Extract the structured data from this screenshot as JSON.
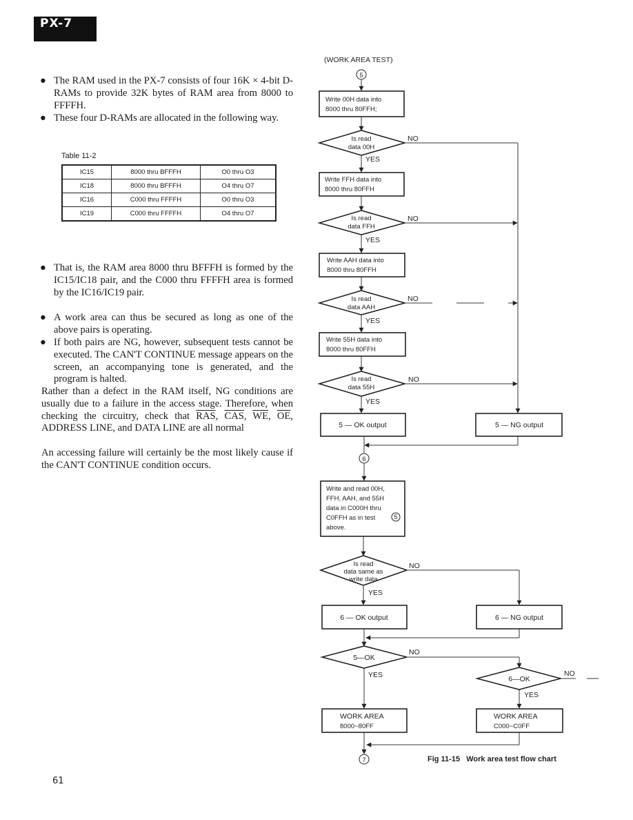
{
  "header": {
    "model": "PX-7"
  },
  "body_text": {
    "bullets_top": [
      "The RAM used in the PX-7 consists of four 16K × 4-bit D-RAMs to provide 32K bytes of RAM area from 8000 to FFFFH.",
      "These four D-RAMs are allocated in the following way."
    ],
    "bullets_bottom": [
      "That is, the RAM area 8000 thru BFFFH is formed by the IC15/IC18 pair, and the C000 thru FFFFH area is formed by the IC16/IC19 pair.",
      "A work area can thus be secured as long as one of the above pairs is operating.",
      "If both pairs are NG, however, subsequent tests cannot be executed. The CAN'T CONTINUE message appears on the screen, an accompanying tone is generated, and the program is halted."
    ],
    "para_access_1": "Rather than a defect in the RAM itself, NG conditions are usually due to a failure in the access stage. Therefore, when checking the circuitry, check that",
    "signals": [
      "RAS",
      "CAS",
      "WE",
      "OE"
    ],
    "para_access_2": ", ADDRESS LINE, and DATA LINE are all normal",
    "para_failure": "An accessing failure will certainly be the most likely cause if the CAN'T CONTINUE condition occurs."
  },
  "table": {
    "caption": "Table 11-2",
    "rows": [
      [
        "IC15",
        "8000 thru BFFFH",
        "O0 thru O3"
      ],
      [
        "IC18",
        "8000 thru BFFFH",
        "O4 thru O7"
      ],
      [
        "IC16",
        "C000 thru FFFFH",
        "O0 thru O3"
      ],
      [
        "IC19",
        "C000 thru FFFFH",
        "O4 thru O7"
      ]
    ]
  },
  "flowchart": {
    "title": "(WORK AREA TEST)",
    "connectors": {
      "start": "5",
      "mid": "6",
      "end": "7"
    },
    "write_00": [
      "Write 00H data into",
      "8000 thru 80FFH;"
    ],
    "check_00": [
      "Is read",
      "data 00H"
    ],
    "write_ff": [
      "Write FFH data into",
      "8000 thru 80FFH"
    ],
    "check_ff": [
      "Is read",
      "data FFH"
    ],
    "write_aa": [
      "Write AAH data into",
      "8000 thru 80FFH"
    ],
    "check_aa": [
      "Is read",
      "data AAH"
    ],
    "write_55": [
      "Write 55H data into",
      "8000 thru 80FFH"
    ],
    "check_55": [
      "Is read",
      "data 55H"
    ],
    "ok5": "5 — OK output",
    "ng5": "5 — NG output",
    "write_c000": [
      "Write and read 00H,",
      "FFH, AAH, and 55H",
      "data in C000H thru",
      "C0FFH as in test",
      "above."
    ],
    "write_c000_ref": "5",
    "check_same": [
      "Is read",
      "data same as",
      "write data"
    ],
    "ok6": "6 — OK output",
    "ng6": "6 — NG output",
    "dec5": "5—OK",
    "dec6": "6—OK",
    "work_8000": [
      "WORK AREA",
      "8000~80FF"
    ],
    "work_c000": [
      "WORK AREA",
      "C000~C0FF"
    ],
    "yes": "YES",
    "no": "NO",
    "caption": "Fig 11-15   Work area test flow chart"
  },
  "footer": {
    "page_number": "61"
  }
}
